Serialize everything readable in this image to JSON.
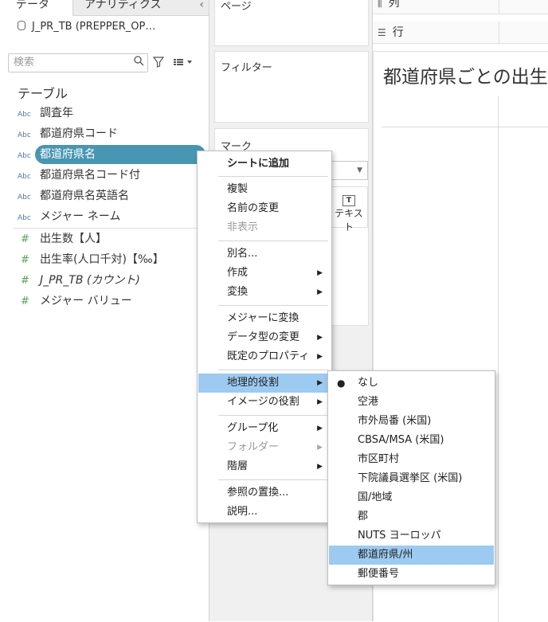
{
  "data_pane": {
    "tab_data": "データ",
    "tab_analytics": "アナリティクス",
    "collapse": "‹",
    "datasource": "J_PR_TB (PREPPER_OP…",
    "search_placeholder": "検索",
    "table_header": "テーブル",
    "dimensions": [
      {
        "type": "Abc",
        "label": "調査年"
      },
      {
        "type": "Abc",
        "label": "都道府県コード"
      },
      {
        "type": "Abc",
        "label": "都道府県名"
      },
      {
        "type": "Abc",
        "label": "都道府県名コード付"
      },
      {
        "type": "Abc",
        "label": "都道府県名英語名"
      },
      {
        "type": "Abc",
        "label": "メジャー ネーム"
      }
    ],
    "measures": [
      {
        "type": "#",
        "label": "出生数【人】"
      },
      {
        "type": "#",
        "label": "出生率(人口千対)【‰】"
      },
      {
        "type": "#",
        "label": "J_PR_TB (カウント)"
      },
      {
        "type": "#",
        "label": "メジャー バリュー"
      }
    ]
  },
  "shelves": {
    "pages": "ページ",
    "filters": "フィルター",
    "marks": "マーク",
    "text_button": "テキスト",
    "text_icon": "T",
    "columns_icon": "⫼",
    "columns": "列",
    "rows_icon": "☰",
    "rows": "行"
  },
  "viz": {
    "title": "都道府県ごとの出生"
  },
  "context_menu": {
    "items": [
      "シートに追加",
      "複製",
      "名前の変更",
      "非表示",
      "別名...",
      "作成",
      "変換",
      "メジャーに変換",
      "データ型の変更",
      "既定のプロパティ",
      "地理的役割",
      "イメージの役割",
      "グループ化",
      "フォルダー",
      "階層",
      "参照の置換...",
      "説明..."
    ],
    "arrow": "▶"
  },
  "geo_submenu": {
    "items": [
      "なし",
      "空港",
      "市外局番 (米国)",
      "CBSA/MSA (米国)",
      "市区町村",
      "下院議員選挙区 (米国)",
      "国/地域",
      "郡",
      "NUTS ヨーロッパ",
      "都道府県/州",
      "郵便番号"
    ],
    "checked_mark": "●",
    "highlighted": "都道府県/州"
  },
  "colors": {
    "selection": "#4996b2",
    "menu_highlight": "#9ccaf1",
    "dimension_icon": "#4e79a7",
    "measure_icon": "#5aa05a"
  }
}
